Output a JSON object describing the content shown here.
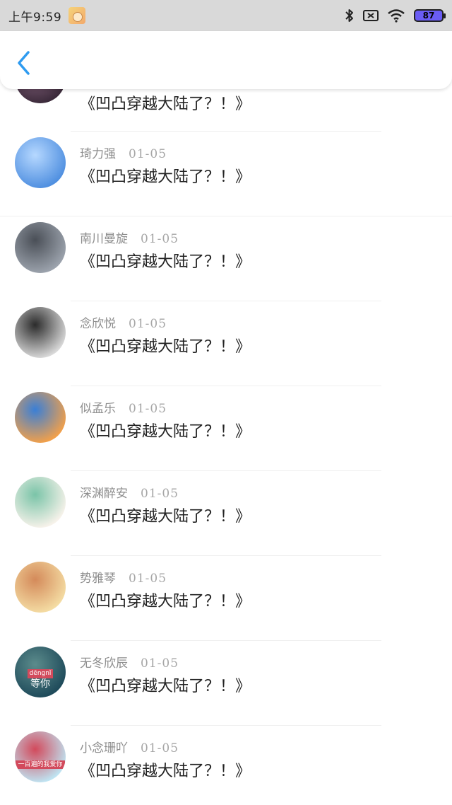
{
  "status_bar": {
    "time": "上午9:59",
    "battery": "87"
  },
  "nav": {
    "back_label": ""
  },
  "messages": [
    {
      "name": "",
      "date": "",
      "text": "《凹凸穿越大陆了？！》",
      "avatar_colors": [
        "#3b2a3a",
        "#8f6a86"
      ]
    },
    {
      "name": "琦力强",
      "date": "01-05",
      "text": "《凹凸穿越大陆了？！》",
      "avatar_colors": [
        "#4f8fe0",
        "#b6d8ff"
      ]
    },
    {
      "name": "南川曼旋",
      "date": "01-05",
      "text": "《凹凸穿越大陆了？！》",
      "avatar_colors": [
        "#9ca3ad",
        "#4a4f57"
      ]
    },
    {
      "name": "念欣悦",
      "date": "01-05",
      "text": "《凹凸穿越大陆了？！》",
      "avatar_colors": [
        "#d9d9d9",
        "#2b2b2b"
      ]
    },
    {
      "name": "似孟乐",
      "date": "01-05",
      "text": "《凹凸穿越大陆了？！》",
      "avatar_colors": [
        "#f2a04a",
        "#3a7fd6"
      ]
    },
    {
      "name": "深渊醉安",
      "date": "01-05",
      "text": "《凹凸穿越大陆了？！》",
      "avatar_colors": [
        "#f7f2ea",
        "#7ac4a8"
      ]
    },
    {
      "name": "势雅琴",
      "date": "01-05",
      "text": "《凹凸穿越大陆了？！》",
      "avatar_colors": [
        "#f4dca3",
        "#d48a5a"
      ]
    },
    {
      "name": "无冬欣辰",
      "date": "01-05",
      "text": "《凹凸穿越大陆了？！》",
      "avatar_colors": [
        "#1e4a5a",
        "#5c8c8c"
      ],
      "avatar_text": [
        "dēngnǐ",
        "等你"
      ]
    },
    {
      "name": "小念珊吖",
      "date": "01-05",
      "text": "《凹凸穿越大陆了？！》",
      "avatar_colors": [
        "#bfe4f2",
        "#d24a5c"
      ],
      "avatar_text": [
        "",
        "一百遍的我爱你"
      ]
    }
  ]
}
